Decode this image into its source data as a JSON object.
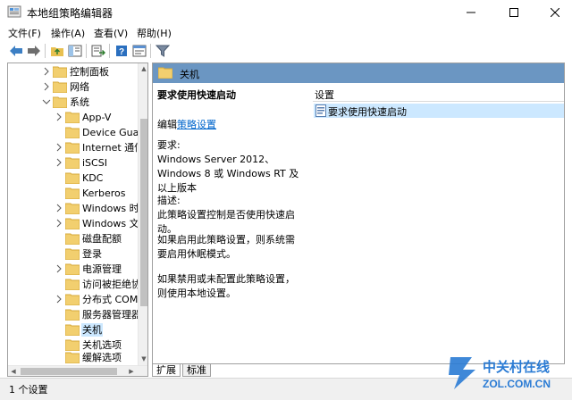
{
  "window": {
    "title": "本地组策略编辑器",
    "controls": {
      "minimize": "minimize-icon",
      "maximize": "maximize-icon",
      "close": "close-icon"
    }
  },
  "menu": [
    "文件(F)",
    "操作(A)",
    "查看(V)",
    "帮助(H)"
  ],
  "toolbar": [
    "back-arrow-icon",
    "forward-arrow-icon",
    "up-folder-icon",
    "show-hide-tree-icon",
    "export-list-icon",
    "help-icon",
    "properties-icon",
    "filter-icon"
  ],
  "tree": {
    "items": [
      {
        "label": "控制面板",
        "expandable": true,
        "expanded": false,
        "level": 3
      },
      {
        "label": "网络",
        "expandable": true,
        "expanded": false,
        "level": 3
      },
      {
        "label": "系统",
        "expandable": true,
        "expanded": true,
        "level": 3
      },
      {
        "label": "App-V",
        "expandable": true,
        "expanded": false,
        "level": 4
      },
      {
        "label": "Device Guard",
        "expandable": false,
        "level": 4
      },
      {
        "label": "Internet 通信",
        "expandable": true,
        "expanded": false,
        "level": 4
      },
      {
        "label": "iSCSI",
        "expandable": true,
        "expanded": false,
        "level": 4
      },
      {
        "label": "KDC",
        "expandable": false,
        "level": 4
      },
      {
        "label": "Kerberos",
        "expandable": false,
        "level": 4
      },
      {
        "label": "Windows 时",
        "expandable": true,
        "expanded": false,
        "level": 4
      },
      {
        "label": "Windows 文",
        "expandable": true,
        "expanded": false,
        "level": 4
      },
      {
        "label": "磁盘配额",
        "expandable": false,
        "level": 4
      },
      {
        "label": "登录",
        "expandable": false,
        "level": 4
      },
      {
        "label": "电源管理",
        "expandable": true,
        "expanded": false,
        "level": 4
      },
      {
        "label": "访问被拒绝协",
        "expandable": false,
        "level": 4
      },
      {
        "label": "分布式 COM",
        "expandable": true,
        "expanded": false,
        "level": 4
      },
      {
        "label": "服务器管理器",
        "expandable": false,
        "level": 4
      },
      {
        "label": "关机",
        "expandable": false,
        "level": 4,
        "selected": true
      },
      {
        "label": "关机选项",
        "expandable": false,
        "level": 4
      },
      {
        "label": "缓解选项",
        "expandable": false,
        "level": 4
      }
    ]
  },
  "content": {
    "header": "关机",
    "policy_title": "要求使用快速启动",
    "edit_prefix": "编辑",
    "edit_link": "策略设置",
    "requirements": "要求:\nWindows Server 2012、Windows 8 或 Windows RT 及以上版本",
    "description": "描述:\n此策略设置控制是否使用快速启动。",
    "if_enabled": "如果启用此策略设置，则系统需要启用休眠模式。",
    "if_disabled": "如果禁用或未配置此策略设置，则使用本地设置。",
    "list_header": "设置",
    "list_items": [
      "要求使用快速启动"
    ]
  },
  "tabs": [
    "扩展",
    "标准"
  ],
  "status": "1 个设置",
  "watermark": {
    "brand": "中关村在线",
    "url": "ZOL.COM.CN"
  }
}
